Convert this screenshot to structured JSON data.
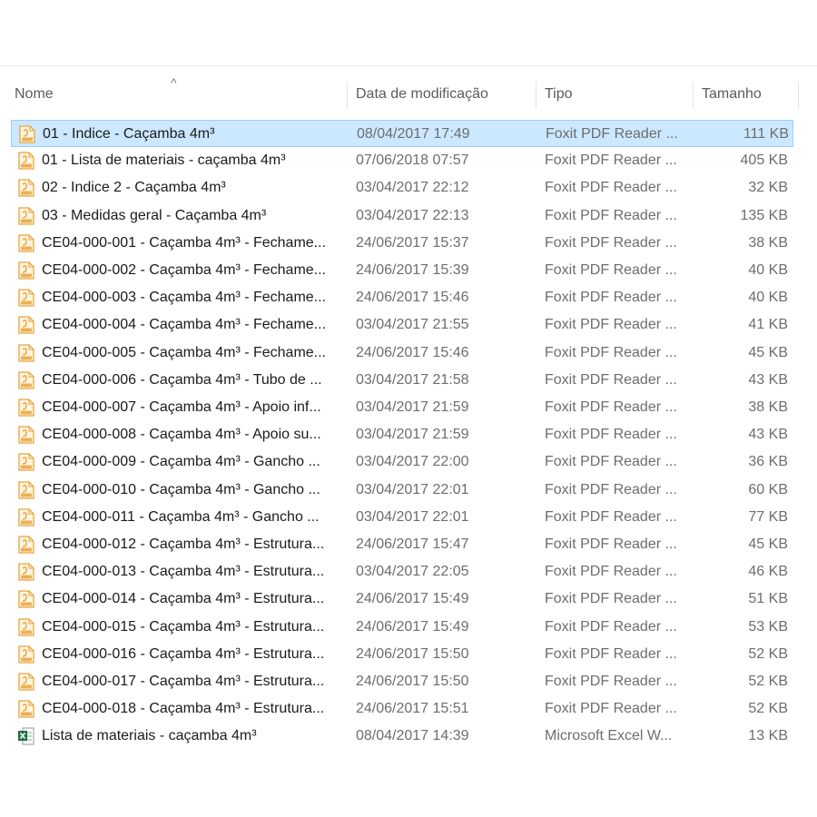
{
  "columns": {
    "name": "Nome",
    "date": "Data de modificação",
    "type": "Tipo",
    "size": "Tamanho"
  },
  "colors": {
    "selection_bg": "#cce8ff",
    "selection_border": "#99d1ff",
    "pdf_icon": "#e8a33d",
    "excel_icon": "#1e7145"
  },
  "files": [
    {
      "name": "01 - Indice - Caçamba 4m³",
      "date": "08/04/2017 17:49",
      "type": "Foxit PDF Reader ...",
      "size": "111 KB",
      "icon": "pdf-file-icon",
      "selected": true
    },
    {
      "name": "01 - Lista de materiais - caçamba 4m³",
      "date": "07/06/2018 07:57",
      "type": "Foxit PDF Reader ...",
      "size": "405 KB",
      "icon": "pdf-file-icon"
    },
    {
      "name": "02 - Indice 2 - Caçamba 4m³",
      "date": "03/04/2017 22:12",
      "type": "Foxit PDF Reader ...",
      "size": "32 KB",
      "icon": "pdf-file-icon"
    },
    {
      "name": "03 - Medidas geral - Caçamba 4m³",
      "date": "03/04/2017 22:13",
      "type": "Foxit PDF Reader ...",
      "size": "135 KB",
      "icon": "pdf-file-icon"
    },
    {
      "name": "CE04-000-001 - Caçamba 4m³ - Fechame...",
      "date": "24/06/2017 15:37",
      "type": "Foxit PDF Reader ...",
      "size": "38 KB",
      "icon": "pdf-file-icon"
    },
    {
      "name": "CE04-000-002 - Caçamba 4m³ - Fechame...",
      "date": "24/06/2017 15:39",
      "type": "Foxit PDF Reader ...",
      "size": "40 KB",
      "icon": "pdf-file-icon"
    },
    {
      "name": "CE04-000-003 - Caçamba 4m³ - Fechame...",
      "date": "24/06/2017 15:46",
      "type": "Foxit PDF Reader ...",
      "size": "40 KB",
      "icon": "pdf-file-icon"
    },
    {
      "name": "CE04-000-004 - Caçamba 4m³ - Fechame...",
      "date": "03/04/2017 21:55",
      "type": "Foxit PDF Reader ...",
      "size": "41 KB",
      "icon": "pdf-file-icon"
    },
    {
      "name": "CE04-000-005 - Caçamba 4m³ - Fechame...",
      "date": "24/06/2017 15:46",
      "type": "Foxit PDF Reader ...",
      "size": "45 KB",
      "icon": "pdf-file-icon"
    },
    {
      "name": "CE04-000-006 - Caçamba 4m³ - Tubo de ...",
      "date": "03/04/2017 21:58",
      "type": "Foxit PDF Reader ...",
      "size": "43 KB",
      "icon": "pdf-file-icon"
    },
    {
      "name": "CE04-000-007 - Caçamba 4m³ - Apoio inf...",
      "date": "03/04/2017 21:59",
      "type": "Foxit PDF Reader ...",
      "size": "38 KB",
      "icon": "pdf-file-icon"
    },
    {
      "name": "CE04-000-008 - Caçamba 4m³ - Apoio su...",
      "date": "03/04/2017 21:59",
      "type": "Foxit PDF Reader ...",
      "size": "43 KB",
      "icon": "pdf-file-icon"
    },
    {
      "name": "CE04-000-009 - Caçamba 4m³ - Gancho ...",
      "date": "03/04/2017 22:00",
      "type": "Foxit PDF Reader ...",
      "size": "36 KB",
      "icon": "pdf-file-icon"
    },
    {
      "name": "CE04-000-010 - Caçamba 4m³ - Gancho ...",
      "date": "03/04/2017 22:01",
      "type": "Foxit PDF Reader ...",
      "size": "60 KB",
      "icon": "pdf-file-icon"
    },
    {
      "name": "CE04-000-011 - Caçamba 4m³ - Gancho ...",
      "date": "03/04/2017 22:01",
      "type": "Foxit PDF Reader ...",
      "size": "77 KB",
      "icon": "pdf-file-icon"
    },
    {
      "name": "CE04-000-012 - Caçamba 4m³ - Estrutura...",
      "date": "24/06/2017 15:47",
      "type": "Foxit PDF Reader ...",
      "size": "45 KB",
      "icon": "pdf-file-icon"
    },
    {
      "name": "CE04-000-013 - Caçamba 4m³ - Estrutura...",
      "date": "03/04/2017 22:05",
      "type": "Foxit PDF Reader ...",
      "size": "46 KB",
      "icon": "pdf-file-icon"
    },
    {
      "name": "CE04-000-014 - Caçamba 4m³ - Estrutura...",
      "date": "24/06/2017 15:49",
      "type": "Foxit PDF Reader ...",
      "size": "51 KB",
      "icon": "pdf-file-icon"
    },
    {
      "name": "CE04-000-015 - Caçamba 4m³ - Estrutura...",
      "date": "24/06/2017 15:49",
      "type": "Foxit PDF Reader ...",
      "size": "53 KB",
      "icon": "pdf-file-icon"
    },
    {
      "name": "CE04-000-016 - Caçamba 4m³ - Estrutura...",
      "date": "24/06/2017 15:50",
      "type": "Foxit PDF Reader ...",
      "size": "52 KB",
      "icon": "pdf-file-icon"
    },
    {
      "name": "CE04-000-017 - Caçamba 4m³ - Estrutura...",
      "date": "24/06/2017 15:50",
      "type": "Foxit PDF Reader ...",
      "size": "52 KB",
      "icon": "pdf-file-icon"
    },
    {
      "name": "CE04-000-018 - Caçamba 4m³ - Estrutura...",
      "date": "24/06/2017 15:51",
      "type": "Foxit PDF Reader ...",
      "size": "52 KB",
      "icon": "pdf-file-icon"
    },
    {
      "name": "Lista de materiais - caçamba 4m³",
      "date": "08/04/2017 14:39",
      "type": "Microsoft Excel W...",
      "size": "13 KB",
      "icon": "excel-file-icon"
    }
  ]
}
